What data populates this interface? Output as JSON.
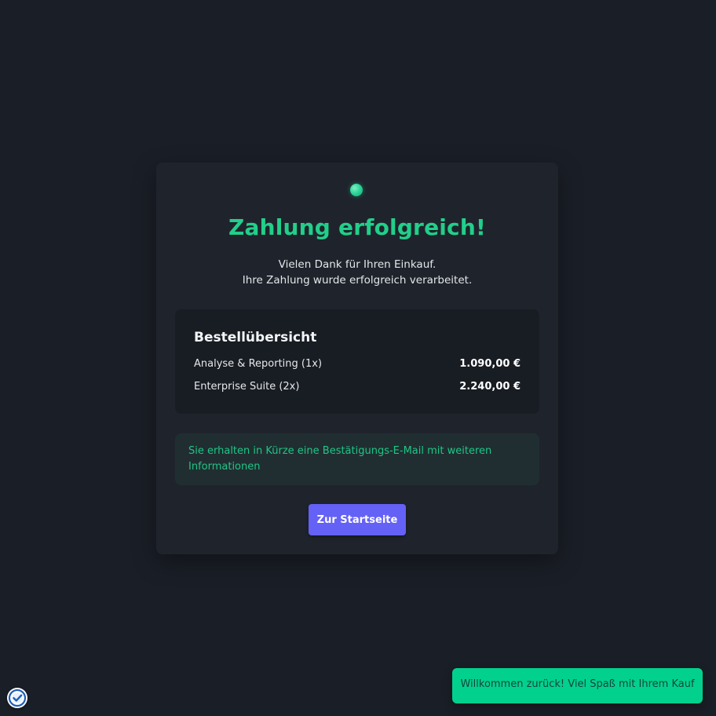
{
  "card": {
    "title": "Zahlung erfolgreich!",
    "subtitle_line1": "Vielen Dank für Ihren Einkauf.",
    "subtitle_line2": "Ihre Zahlung wurde erfolgreich verarbeitet.",
    "status_icon": "success-dot",
    "summary": {
      "title": "Bestellübersicht",
      "items": [
        {
          "name": "Analyse & Reporting (1x)",
          "price": "1.090,00 €"
        },
        {
          "name": "Enterprise Suite (2x)",
          "price": "2.240,00 €"
        }
      ]
    },
    "notice": "Sie erhalten in Kürze eine Bestätigungs-E-Mail mit weiteren Informationen",
    "home_button_label": "Zur Startseite"
  },
  "toast": {
    "message": "Willkommen zurück! Viel Spaß mit Ihrem Kauf"
  },
  "badge": {
    "icon": "verified-check-icon"
  },
  "colors": {
    "background": "#1a1e26",
    "card": "#1f242c",
    "success": "#22cf8a",
    "button": "#6461f6",
    "toast": "#02d18e"
  }
}
